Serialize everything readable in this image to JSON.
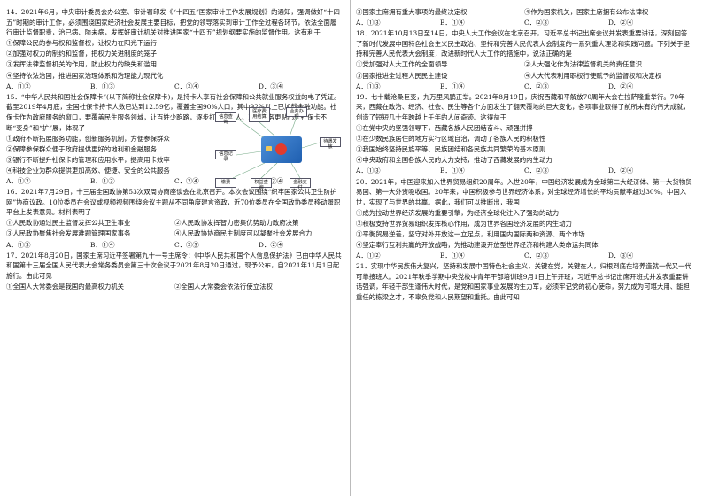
{
  "left": {
    "q14": {
      "stem": "14．2021年6月，中央审计委员会办公室、审计署印发《“十四五”国家审计工作发展规划》的通知，强调做好“十四五”时期的审计工作，必须围绕国家经济社会发展主要目标，把党的领导落实到审计工作全过程各环节，依法全面履行审计监督职责，治已病、防未病，发挥好审计机关对推进国家“十四五”规划纲要实施的监督作用。这有利于",
      "items": [
        "①保障公民的参与权和监督权，让权力在阳光下运行",
        "②加强对权力的制约和监督，把权力关进制度的笼子",
        "③发挥法律监督机关的作用，防止权力的缺失和滥用",
        "④坚持依法治国，推进国家治理体系和治理能力现代化"
      ],
      "choices": [
        "A．①②",
        "B．①③",
        "C．②④",
        "D．③④"
      ]
    },
    "q15": {
      "stem": "15．“中华人民共和国社会保障卡”(以下简称社会保障卡)，是持卡人享有社会保障和公共就业服务权益的电子凭证。截至2019年4月底，全国社保卡持卡人数已达到12.59亿，覆盖全国90%人口，其中92%以上已加载金融功能。社保卡作为政府服务的窗口，要覆盖民生服务领域，让百姓少跑路，逐步打造持卡人、政府服务更贴心。社保卡不断“变身”和“扩”展，体现了",
      "items": [
        "①政府不断拓展服务功能，创新服务机制，方便参保群众",
        "②保障参保群众便于政府提供更好的地利和金融服务",
        "③银行不断提升社保卡的管理和应用水平，提高用卡效率",
        "④科技企业为群众提供更加高效、便捷、安全的公共服务"
      ],
      "choices": [
        "A．①②",
        "B．①③",
        "C．②④",
        "D．③④"
      ],
      "diagram": {
        "boxes": [
          "信息查询",
          "医疗费用结算",
          "业务办理",
          "待遇发放",
          "信息记录",
          "缴费",
          "权益查询",
          "金融支付"
        ]
      }
    },
    "q16": {
      "stem": "16．2021年7月29日，十三届全国政协第53次双周协商座谈会在北京召开。本次会议围绕“织牢国家公共卫生防护网”协商议政。10位委员在会议或视频视频围绕会议主题从不同角度建言资政，近70位委员在全国政协委员移动履职平台上发表意见。材料表明了",
      "items": [
        "①人民政协通过民主监督发挥公共卫生事业",
        "②人民政协发挥智力密集优势助力政府决策",
        "③人民政协聚焦社会发展难题管理国家事务",
        "④人民政协协商民主制度可以凝聚社会发展合力"
      ],
      "choices": [
        "A．①③",
        "B．①④",
        "C．②③",
        "D．②④"
      ]
    },
    "q17": {
      "stem": "17．2021年8月20日，国家主席习近平签署第九十一号主席令：《中华人民共和国个人信息保护法》已由中华人民共和国第十三届全国人民代表大会常务委员会第三十次会议于2021年8月20日通过，现予公布，自2021年11月1日起施行。由此可见",
      "items": [
        "①全国人大常委会是我国的最高权力机关",
        "②全国人大常委会依法行使立法权"
      ]
    }
  },
  "right": {
    "q17cont": {
      "items": [
        "③国家主席拥有重大事项的最终决定权",
        "④作为国家机关，国家主席拥有公布法律权"
      ],
      "choices": [
        "A．①③",
        "B．①④",
        "C．②③",
        "D．②④"
      ]
    },
    "q18": {
      "stem": "18．2021年10月13日至14日，中央人大工作会议在北京召开，习近平总书记出席会议并发表重要讲话，深刻回答了新时代发展中国特色社会主义民主政治、坚持和完善人民代表大会制度的一系列重大理论和实践问题。下列关于坚持和完善人民代表大会制度，改进新时代人大工作的措施中，说法正确的是",
      "items": [
        "①党加强对人大工作的全面领导",
        "②人大强化作为法律监督机关的责任意识",
        "③国家推进全过程人民民主建设",
        "④人大代表利用职权行使赋予的监督权和决定权"
      ],
      "choices": [
        "A．①③",
        "B．①④",
        "C．②③",
        "D．②④"
      ]
    },
    "q19": {
      "stem": "19．七十载沧桑巨变，九万里风鹏正举。2021年8月19日，庆祝西藏和平解放70周年大会在拉萨隆重举行。70年来，西藏在政治、经济、社会、民生等各个方面发生了翻天覆地的巨大变化，各项事业取得了前所未有的伟大成就，创造了短短几十年跨越上千年的人间奇迹。这得益于",
      "items": [
        "①在党中央的坚强领导下，西藏各族人民团结奋斗、顽强拼搏",
        "②在少数民族居住的地方实行区域自治，调动了各族人民的积极性",
        "③我国始终坚持民族平等、民族团结和各民族共同繁荣的基本原则",
        "④中央政府和全国各族人民的大力支持，推动了西藏发展的内生动力"
      ],
      "choices": [
        "A．①③",
        "B．①④",
        "C．②③",
        "D．②④"
      ]
    },
    "q20": {
      "stem": "20．2021年，中国迎来加入世界贸易组织20周年。入世20年，中国经济发展成为全球第二大经济体、第一大货物贸易国、第一大外资吸收国。20年来，中国积极参与世界经济体系，对全球经济增长的平均贡献率超过30%。中国入世，实现了与世界的共赢。据此，我们可以推断出，我国",
      "items": [
        "①成为拉动世界经济发展的重要引擎，为经济全球化注入了强劲的动力",
        "②积极支持世界贸易组织发挥核心作用，成为世界各国经济发展的内生动力",
        "③平衡贸易逆差，坚守对外开放这一立足点，利用国内国际两种资源、两个市场",
        "④坚定奉行互利共赢的开放战略，为推动建设开放型世界经济和构建人类命运共同体"
      ],
      "choices": [
        "A．①②",
        "B．①④",
        "C．②③",
        "D．③④"
      ]
    },
    "q21": {
      "stem": "21．实现中华民族伟大复兴，坚持和发展中国特色社会主义，关键在党，关键在人，归根到底在培养造就一代又一代可靠接班人。2021年秋季学期中央党校中青年干部培训班9月1日上午开班，习近平总书记出席开班式并发表重要讲话强调，年轻干部生逢伟大时代，是党和国家事业发展的生力军，必须牢记党的初心使命，努力成为可堪大用、能担重任的栋梁之才，不辜负党和人民期望和重托。由此可知"
    }
  }
}
